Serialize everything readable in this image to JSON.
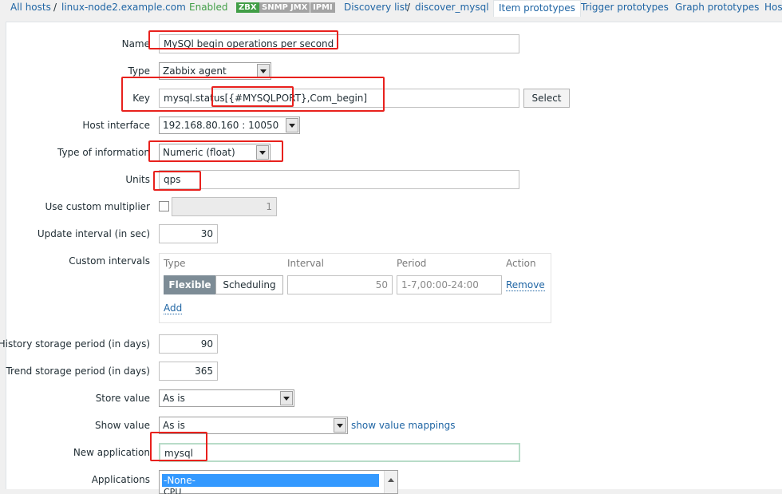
{
  "breadcrumb": {
    "all_hosts": "All hosts",
    "sep": "/",
    "host": "linux-node2.example.com",
    "status": "Enabled",
    "badges": [
      "ZBX",
      "SNMP",
      "JMX",
      "IPMI"
    ],
    "discovery_list": "Discovery list",
    "discovery_rule": "discover_mysql",
    "tabs": [
      "Item prototypes",
      "Trigger prototypes",
      "Graph prototypes",
      "Hos"
    ]
  },
  "colors": {
    "link": "#1f65a4",
    "enabled": "#429e47",
    "zbx_badge": "#429e47",
    "annotation_red": "#e8211d"
  },
  "form": {
    "name": {
      "label": "Name",
      "value": "MySQl begin operations per second"
    },
    "type": {
      "label": "Type",
      "value": "Zabbix agent"
    },
    "key": {
      "label": "Key",
      "value": "mysql.status[{#MYSQLPORT},Com_begin]",
      "select_button": "Select"
    },
    "host_interface": {
      "label": "Host interface",
      "value": "192.168.80.160 : 10050"
    },
    "type_of_information": {
      "label": "Type of information",
      "value": "Numeric (float)"
    },
    "units": {
      "label": "Units",
      "value": "qps"
    },
    "custom_multiplier": {
      "label": "Use custom multiplier",
      "checked": false,
      "value": "1"
    },
    "update_interval": {
      "label": "Update interval (in sec)",
      "value": "30"
    },
    "custom_intervals": {
      "label": "Custom intervals",
      "headers": [
        "Type",
        "Interval",
        "Period",
        "Action"
      ],
      "row": {
        "modes": [
          "Flexible",
          "Scheduling"
        ],
        "active_mode": "Flexible",
        "interval": "50",
        "period": "1-7,00:00-24:00",
        "action": "Remove"
      },
      "add_label": "Add"
    },
    "history": {
      "label": "History storage period (in days)",
      "value": "90"
    },
    "trend": {
      "label": "Trend storage period (in days)",
      "value": "365"
    },
    "store_value": {
      "label": "Store value",
      "value": "As is"
    },
    "show_value": {
      "label": "Show value",
      "value": "As is",
      "link": "show value mappings"
    },
    "new_application": {
      "label": "New application",
      "value": "mysql"
    },
    "applications": {
      "label": "Applications",
      "options": [
        "-None-",
        "CPU"
      ],
      "selected": "-None-"
    }
  }
}
